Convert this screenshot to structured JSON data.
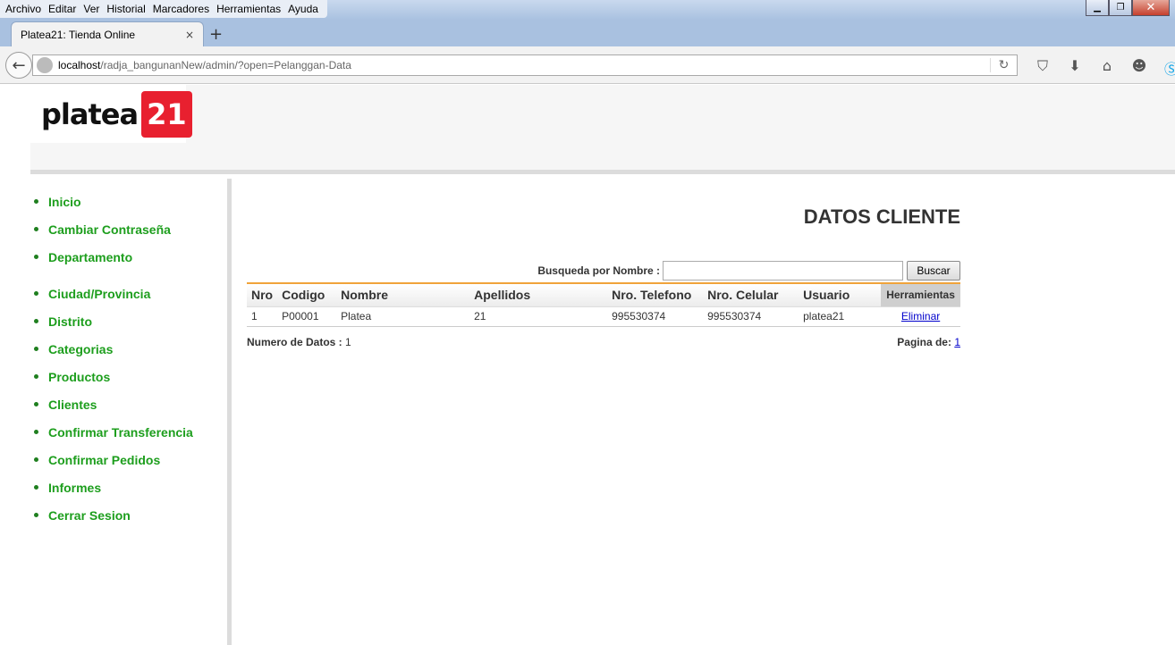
{
  "menu": [
    "Archivo",
    "Editar",
    "Ver",
    "Historial",
    "Marcadores",
    "Herramientas",
    "Ayuda"
  ],
  "tab": {
    "title": "Platea21: Tienda Online",
    "close": "×",
    "new": "+"
  },
  "address": {
    "host": "localhost",
    "path": "/radja_bangunanNew/admin/?open=Pelanggan-Data"
  },
  "logo": {
    "text": "platea",
    "number": "21"
  },
  "sidebar": {
    "items": [
      {
        "label": "Inicio"
      },
      {
        "label": "Cambiar Contraseña"
      },
      {
        "label": "Departamento"
      },
      {
        "label": "Ciudad/Provincia"
      },
      {
        "label": "Distrito"
      },
      {
        "label": "Categorias"
      },
      {
        "label": "Productos"
      },
      {
        "label": "Clientes"
      },
      {
        "label": "Confirmar Transferencia"
      },
      {
        "label": "Confirmar Pedidos"
      },
      {
        "label": "Informes"
      },
      {
        "label": "Cerrar Sesion"
      }
    ]
  },
  "main": {
    "title": "DATOS CLIENTE",
    "search": {
      "label": "Busqueda por Nombre :",
      "value": "",
      "button": "Buscar"
    },
    "table": {
      "headers": [
        "Nro",
        "Codigo",
        "Nombre",
        "Apellidos",
        "Nro. Telefono",
        "Nro. Celular",
        "Usuario",
        "Herramientas"
      ],
      "rows": [
        [
          "1",
          "P00001",
          "Platea",
          "21",
          "995530374",
          "995530374",
          "platea21",
          "Eliminar"
        ]
      ]
    },
    "footer": {
      "count_label": "Numero de Datos :",
      "count": "1",
      "page_label": "Pagina de:",
      "page": "1"
    }
  }
}
